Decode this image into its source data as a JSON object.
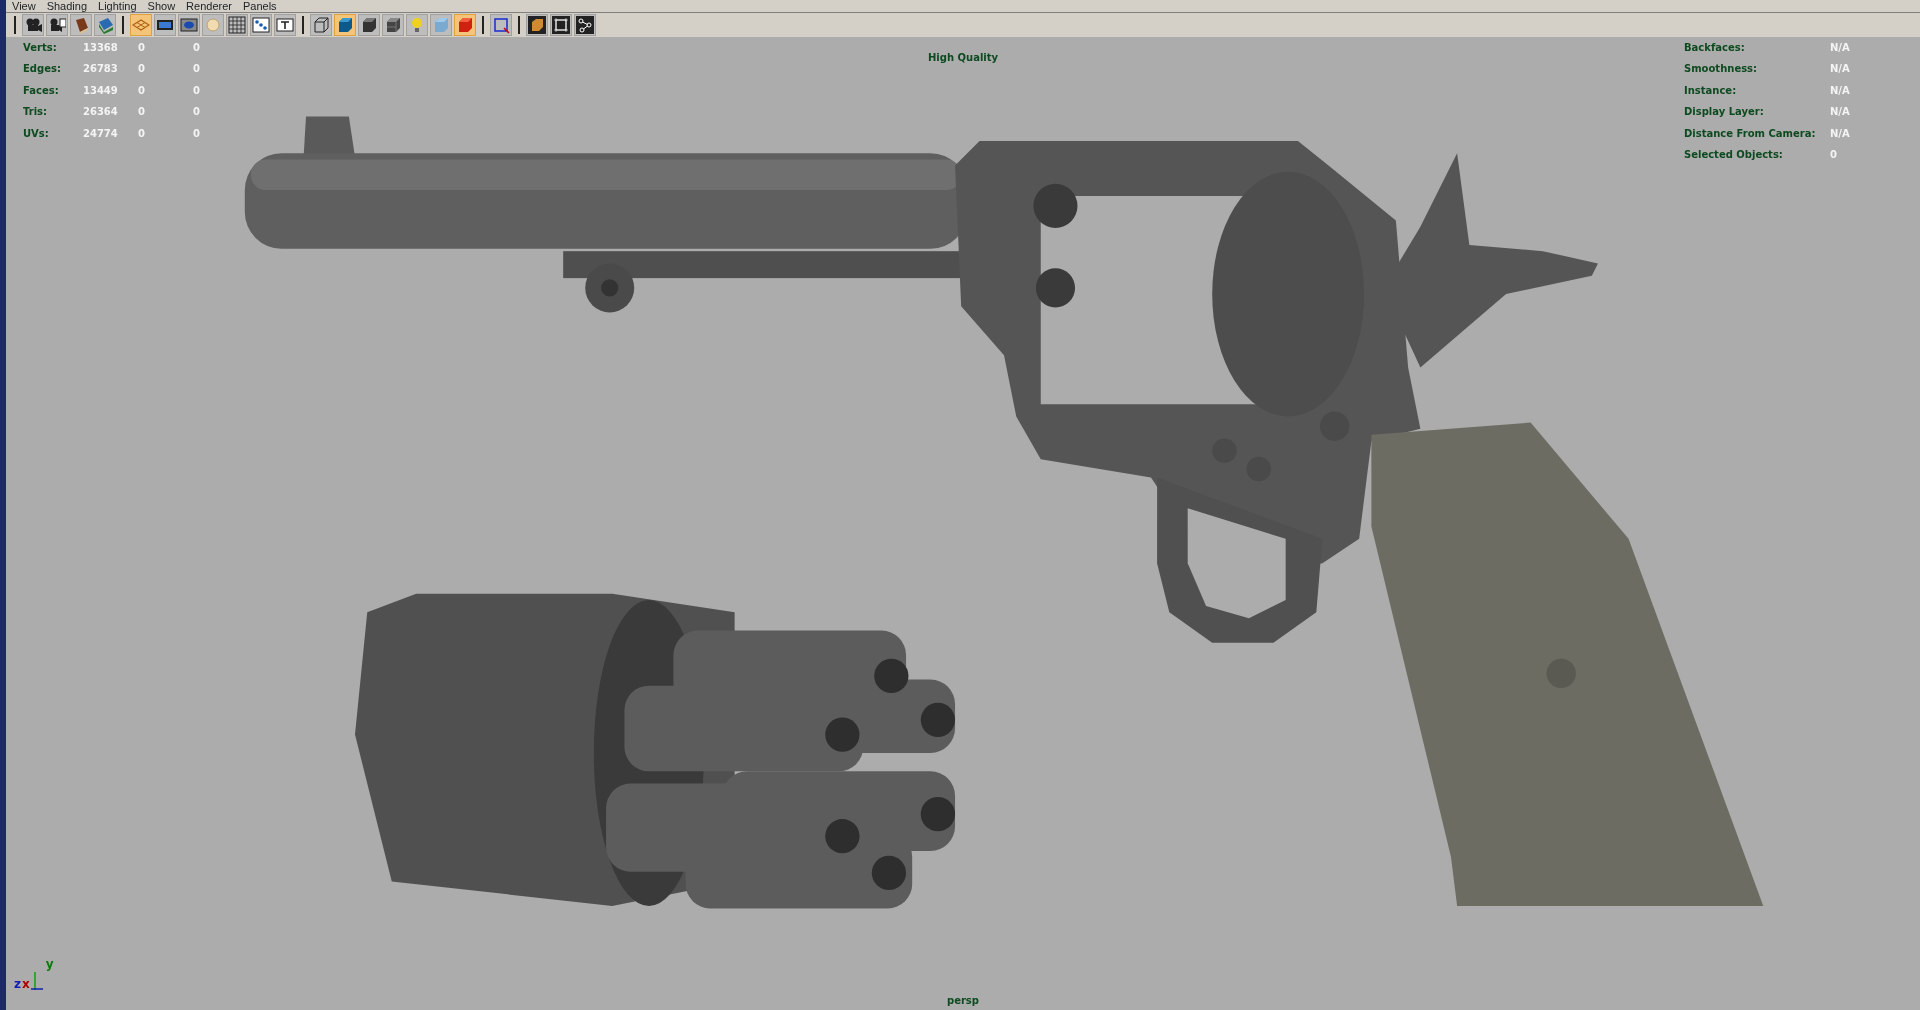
{
  "menu": [
    "View",
    "Shading",
    "Lighting",
    "Show",
    "Renderer",
    "Panels"
  ],
  "toolbar": [
    [
      {
        "kind": "camera",
        "selected": false
      },
      {
        "kind": "camera-attributes",
        "selected": false
      },
      {
        "kind": "book",
        "selected": false
      },
      {
        "kind": "image-plane",
        "selected": false
      }
    ],
    [
      {
        "kind": "grid",
        "selected": true
      },
      {
        "kind": "film-gate",
        "selected": false
      },
      {
        "kind": "resolution-gate",
        "selected": false
      },
      {
        "kind": "disc",
        "selected": false
      },
      {
        "kind": "field-chart",
        "selected": false
      },
      {
        "kind": "safe-action",
        "selected": false
      },
      {
        "kind": "text",
        "selected": false
      }
    ],
    [
      {
        "kind": "wire-cube",
        "selected": false
      },
      {
        "kind": "shaded-cube",
        "selected": true
      },
      {
        "kind": "dark-cube",
        "selected": false
      },
      {
        "kind": "checker-cube",
        "selected": false
      },
      {
        "kind": "bulb",
        "selected": false
      },
      {
        "kind": "pale-cube",
        "selected": false
      },
      {
        "kind": "red-cube",
        "selected": true
      }
    ],
    [
      {
        "kind": "select-frame",
        "selected": false
      }
    ],
    [
      {
        "kind": "box-frame",
        "selected": false
      },
      {
        "kind": "frame",
        "selected": false
      },
      {
        "kind": "node-graph",
        "selected": false
      }
    ]
  ],
  "stats": [
    {
      "label": "Verts:",
      "values": [
        "13368",
        "0",
        "0"
      ]
    },
    {
      "label": "Edges:",
      "values": [
        "26783",
        "0",
        "0"
      ]
    },
    {
      "label": "Faces:",
      "values": [
        "13449",
        "0",
        "0"
      ]
    },
    {
      "label": "Tris:",
      "values": [
        "26364",
        "0",
        "0"
      ]
    },
    {
      "label": "UVs:",
      "values": [
        "24774",
        "0",
        "0"
      ]
    }
  ],
  "object_info": [
    {
      "label": "Backfaces:",
      "value": "N/A"
    },
    {
      "label": "Smoothness:",
      "value": "N/A"
    },
    {
      "label": "Instance:",
      "value": "N/A"
    },
    {
      "label": "Display Layer:",
      "value": "N/A"
    },
    {
      "label": "Distance From Camera:",
      "value": "N/A"
    },
    {
      "label": "Selected Objects:",
      "value": "0"
    }
  ],
  "quality_label": "High Quality",
  "camera_label": "persp",
  "axis_labels": {
    "z": "z",
    "x": "x",
    "y": "y"
  }
}
